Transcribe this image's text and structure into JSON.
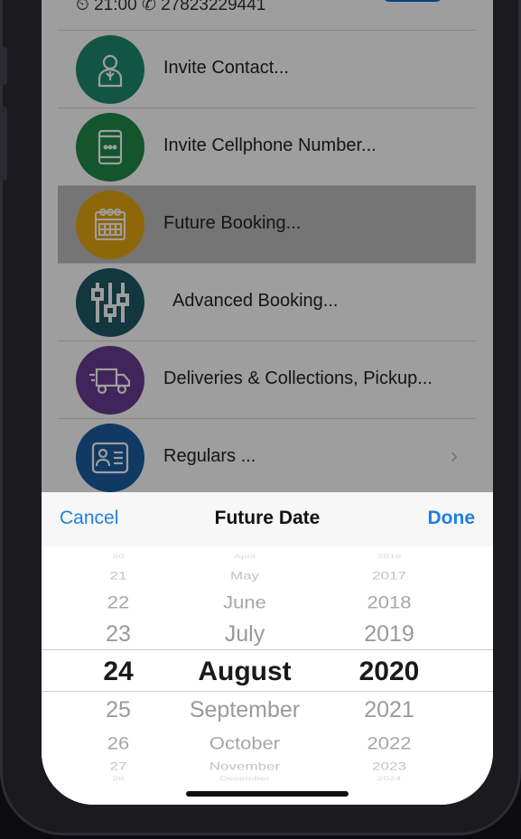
{
  "status": {
    "time": "21:00",
    "phone": "27823229441"
  },
  "menu": {
    "items": [
      {
        "label": "Invite Contact...",
        "icon": "contact-icon",
        "color": "#1f8a6e"
      },
      {
        "label": "Invite Cellphone Number...",
        "icon": "cellphone-icon",
        "color": "#1f8a48"
      },
      {
        "label": "Future Booking...",
        "icon": "calendar-icon",
        "color": "#e6a613"
      },
      {
        "label": "Advanced Booking...",
        "icon": "sliders-icon",
        "color": "#1d5964"
      },
      {
        "label": "Deliveries & Collections, Pickup...",
        "icon": "truck-icon",
        "color": "#6a3a90"
      },
      {
        "label": "Regulars ...",
        "icon": "id-card-icon",
        "color": "#1b5ea0"
      }
    ],
    "chevron": "›"
  },
  "picker": {
    "cancel_label": "Cancel",
    "title": "Future Date",
    "done_label": "Done",
    "days": [
      "20",
      "21",
      "22",
      "23",
      "24",
      "25",
      "26",
      "27",
      "28"
    ],
    "months": [
      "April",
      "May",
      "June",
      "July",
      "August",
      "September",
      "October",
      "November",
      "December"
    ],
    "years": [
      "2016",
      "2017",
      "2018",
      "2019",
      "2020",
      "2021",
      "2022",
      "2023",
      "2024"
    ],
    "selected": {
      "day": "24",
      "month": "August",
      "year": "2020"
    }
  },
  "colors": {
    "accent": "#1f7fe0"
  }
}
